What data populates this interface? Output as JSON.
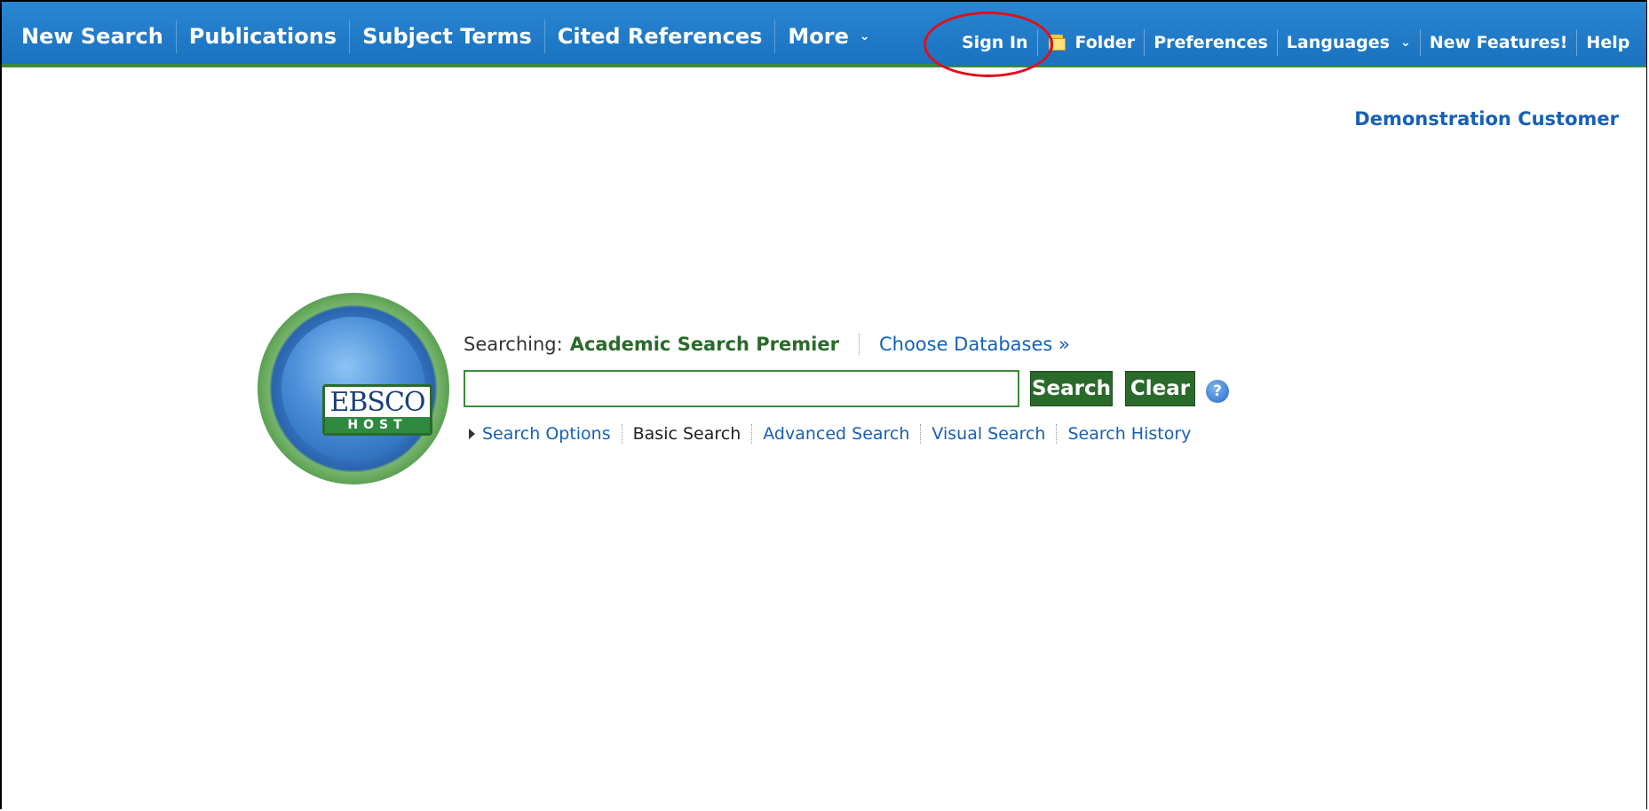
{
  "topnav": {
    "left": [
      "New Search",
      "Publications",
      "Subject Terms",
      "Cited References",
      "More"
    ],
    "right": [
      "Sign In",
      "Folder",
      "Preferences",
      "Languages",
      "New Features!",
      "Help"
    ]
  },
  "customer": "Demonstration Customer",
  "logo": {
    "top": "EBSCO",
    "bottom": "HOST"
  },
  "searching": {
    "label": "Searching:",
    "database": "Academic Search Premier",
    "choose": "Choose Databases »"
  },
  "search": {
    "value": "",
    "placeholder": ""
  },
  "buttons": {
    "search": "Search",
    "clear": "Clear",
    "help": "?"
  },
  "links": [
    "Search Options",
    "Basic Search",
    "Advanced Search",
    "Visual Search",
    "Search History"
  ],
  "colors": {
    "bar": "#1a72c0",
    "accent_green": "#2a6a2a",
    "highlight": "#e0101a",
    "link": "#1560b8"
  }
}
